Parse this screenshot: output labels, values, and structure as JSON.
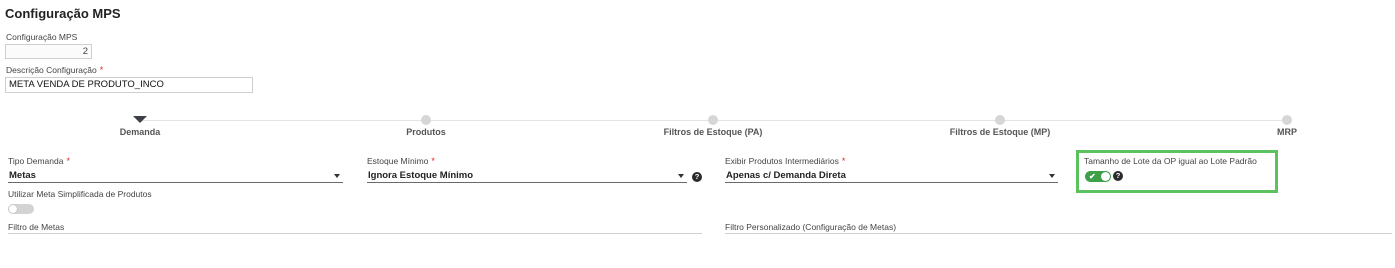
{
  "page": {
    "title": "Configuração MPS"
  },
  "config": {
    "config_label": "Configuração MPS",
    "config_value": "2",
    "description_label": "Descrição Configuração",
    "required_mark": "*",
    "description_value": "META VENDA DE PRODUTO_INCO"
  },
  "stepper": {
    "active_index": 0,
    "steps": [
      {
        "label": "Demanda"
      },
      {
        "label": "Produtos"
      },
      {
        "label": "Filtros de Estoque (PA)"
      },
      {
        "label": "Filtros de Estoque (MP)"
      },
      {
        "label": "MRP"
      }
    ]
  },
  "form": {
    "tipo_demanda": {
      "label": "Tipo Demanda",
      "value": "Metas"
    },
    "estoque_minimo": {
      "label": "Estoque Mínimo",
      "value": "Ignora Estoque Mínimo"
    },
    "exibir_intermediarios": {
      "label": "Exibir Produtos Intermediários",
      "value": "Apenas c/ Demanda Direta"
    },
    "tamanho_lote": {
      "label": "Tamanho de Lote da OP igual ao Lote Padrão",
      "checked": true
    },
    "meta_simplificada": {
      "label": "Utilizar Meta Simplificada de Produtos",
      "checked": false
    },
    "filtro_metas": {
      "label": "Filtro de Metas",
      "value": ""
    },
    "filtro_personalizado": {
      "label": "Filtro Personalizado (Configuração de Metas)",
      "value": ""
    },
    "help_glyph": "?",
    "check_glyph": "✔"
  },
  "colors": {
    "highlight": "#5cc15f",
    "toggle_on": "#3da14a",
    "required": "#e0281f"
  }
}
